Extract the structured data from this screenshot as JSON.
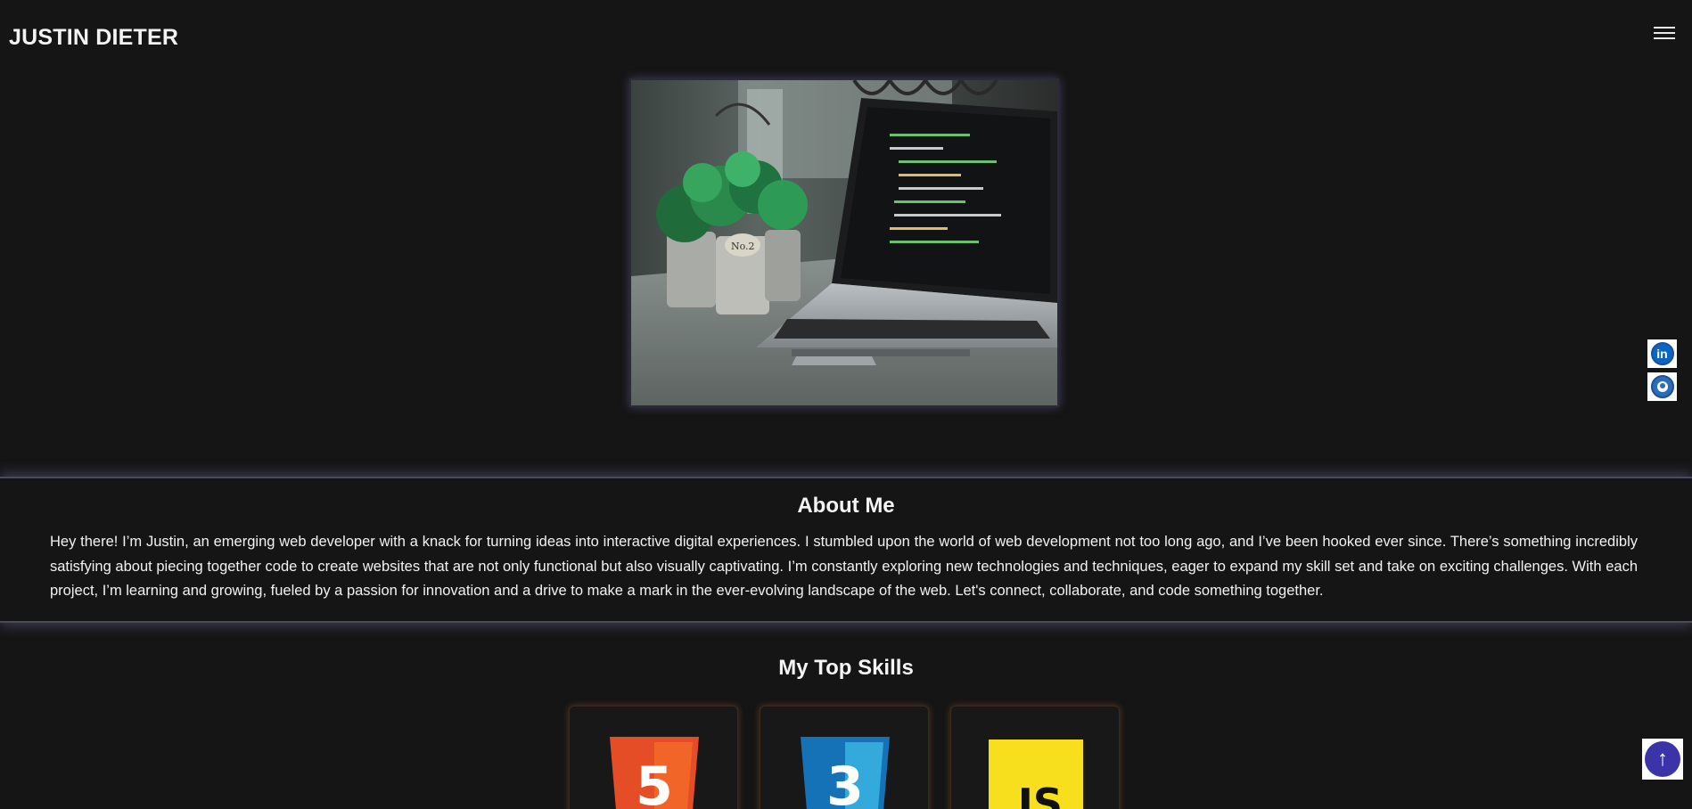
{
  "header": {
    "brand": "JUSTIN DIETER",
    "menu_icon": "hamburger-menu-icon"
  },
  "hero": {
    "alt": "Laptop with code on a desk next to potted plants"
  },
  "social": [
    {
      "name": "linkedin",
      "icon": "linkedin-icon",
      "glyph": "in"
    },
    {
      "name": "github",
      "icon": "github-icon"
    }
  ],
  "about": {
    "title": "About Me",
    "text": "Hey there! I’m Justin, an emerging web developer with a knack for turning ideas into interactive digital experiences. I stumbled upon the world of web development not too long ago, and I’ve been hooked ever since. There’s something incredibly satisfying about piecing together code to create websites that are not only functional but also visually captivating. I’m constantly exploring new technologies and techniques, eager to expand my skill set and take on exciting challenges. With each project, I’m learning and growing, fueled by a passion for innovation and a drive to make a mark in the ever-evolving landscape of the web. Let's connect, collaborate, and code something together."
  },
  "skills": {
    "title": "My Top Skills",
    "items": [
      {
        "name": "HTML5",
        "icon": "html5-icon",
        "glyph": "5",
        "color": "#e44d26"
      },
      {
        "name": "CSS3",
        "icon": "css3-icon",
        "glyph": "3",
        "color": "#1572b6"
      },
      {
        "name": "JavaScript",
        "icon": "javascript-icon",
        "glyph": "JS",
        "color": "#f7df1e"
      }
    ]
  },
  "back_to_top": {
    "icon": "arrow-up-icon",
    "glyph": "↑"
  },
  "colors": {
    "background": "#151515",
    "accent": "#3b34a8",
    "text": "#ffffff"
  }
}
